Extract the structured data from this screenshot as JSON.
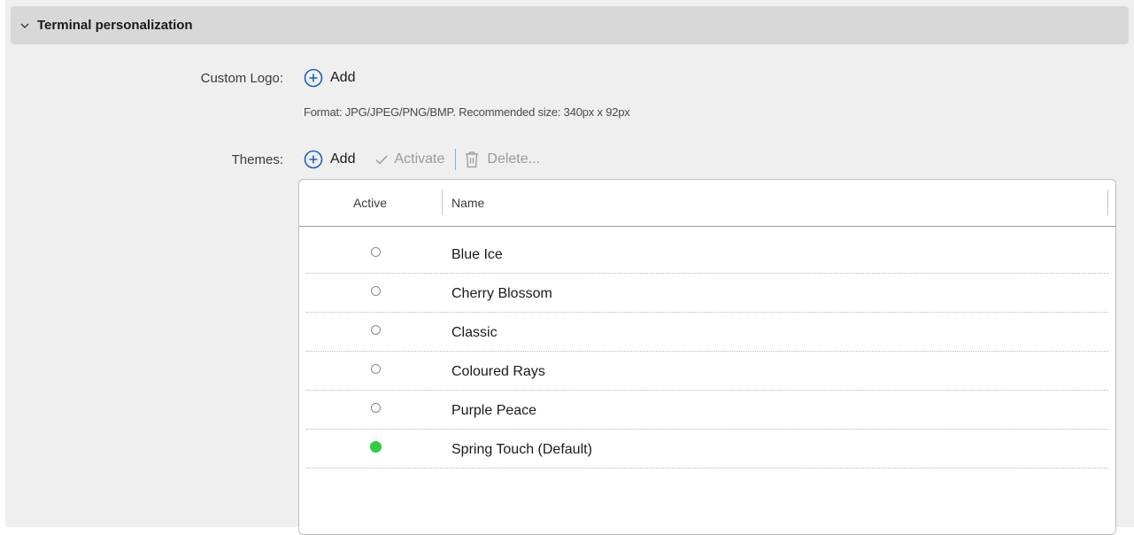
{
  "section": {
    "title": "Terminal personalization",
    "expanded": true
  },
  "custom_logo": {
    "label": "Custom Logo:",
    "add_label": "Add",
    "hint": "Format: JPG/JPEG/PNG/BMP. Recommended size: 340px x 92px"
  },
  "themes": {
    "label": "Themes:",
    "toolbar": {
      "add_label": "Add",
      "activate_label": "Activate",
      "delete_label": "Delete...",
      "activate_enabled": false,
      "delete_enabled": false
    },
    "columns": {
      "active": "Active",
      "name": "Name"
    },
    "rows": [
      {
        "name": "Blue Ice",
        "active": false
      },
      {
        "name": "Cherry Blossom",
        "active": false
      },
      {
        "name": "Classic",
        "active": false
      },
      {
        "name": "Coloured Rays",
        "active": false
      },
      {
        "name": "Purple Peace",
        "active": false
      },
      {
        "name": "Spring Touch (Default)",
        "active": true
      }
    ]
  },
  "colors": {
    "accent": "#1e5fb4",
    "active_indicator": "#2ecc40",
    "header_bg": "#d8d8d8",
    "panel_bg": "#efefef"
  },
  "icons": {
    "section_toggle": "chevron-down-icon",
    "add": "plus-circle-icon",
    "activate": "checkmark-icon",
    "delete": "trash-icon"
  }
}
